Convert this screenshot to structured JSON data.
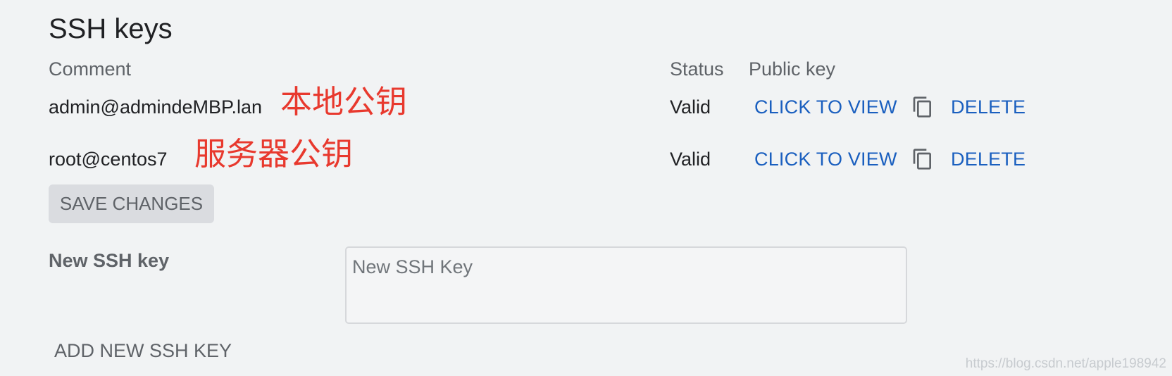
{
  "page": {
    "title": "SSH keys"
  },
  "table": {
    "headers": {
      "comment": "Comment",
      "status": "Status",
      "public_key": "Public key"
    },
    "rows": [
      {
        "comment": "admin@admindeMBP.lan",
        "annotation": "本地公钥",
        "status": "Valid",
        "view_label": "CLICK TO VIEW",
        "copy_icon": "copy-icon",
        "delete_label": "DELETE"
      },
      {
        "comment": "root@centos7",
        "annotation": "服务器公钥",
        "status": "Valid",
        "view_label": "CLICK TO VIEW",
        "copy_icon": "copy-icon",
        "delete_label": "DELETE"
      }
    ]
  },
  "actions": {
    "save_label": "SAVE CHANGES",
    "add_label": "ADD NEW SSH KEY"
  },
  "new_key": {
    "label": "New SSH key",
    "placeholder": "New SSH Key",
    "value": ""
  },
  "watermark": "https://blog.csdn.net/apple198942",
  "colors": {
    "background": "#f1f3f4",
    "link": "#1a5fbf",
    "annotation": "#e8392e",
    "button_bg": "#dadce0"
  }
}
